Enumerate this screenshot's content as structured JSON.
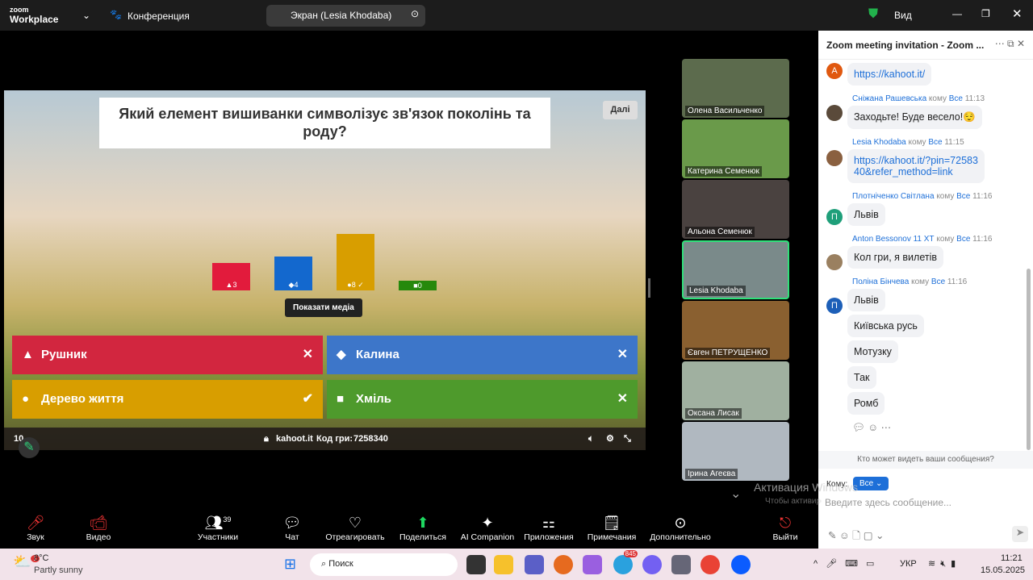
{
  "topbar": {
    "logo_top": "zoom",
    "logo_bottom": "Workplace",
    "meeting": "Конференция",
    "screen_label": "Экран (Lesia Khodaba)",
    "view": "Вид"
  },
  "kahoot": {
    "question": "Який елемент вишиванки символізує зв'язок поколінь та роду?",
    "next": "Далі",
    "bars": [
      "3",
      "4",
      "8",
      "0"
    ],
    "show_media": "Показати медіа",
    "answers": [
      "Рушник",
      "Калина",
      "Дерево життя",
      "Хміль"
    ],
    "counter": "10",
    "site": "kahoot.it",
    "code_label": "Код гри:",
    "code": "7258340"
  },
  "gallery": [
    "Олена Васильченко",
    "Катерина Семенюк",
    "Альона Семенюк",
    "Lesia Khodaba",
    "Євген ПЕТРУЩЕНКО",
    "Оксана Лисак",
    "Ірина Агеєва"
  ],
  "chat": {
    "title": "Zoom meeting invitation - Zoom ...",
    "to_word": "кому",
    "to_all": "Все",
    "messages": [
      {
        "sender": "",
        "time": "",
        "avatar": "A",
        "text": "https://kahoot.it/",
        "link": true
      },
      {
        "sender": "Сніжана Рашевська",
        "time": "11:13",
        "text": "Заходьте! Буде весело!😌"
      },
      {
        "sender": "Lesia Khodaba",
        "time": "11:15",
        "text": "https://kahoot.it/?pin=7258340&refer_method=link",
        "link": true
      },
      {
        "sender": "Плотніченко Світлана",
        "time": "11:16",
        "avatar": "П",
        "text": "Львів"
      },
      {
        "sender": "Anton Bessonov 11 ХТ",
        "time": "11:16",
        "text": "Кол гри, я вилетів"
      },
      {
        "sender": "Поліна Бінчева",
        "time": "11:16",
        "avatar": "П",
        "text": "Львів"
      }
    ],
    "extra": [
      "Київська русь",
      "Мотузку",
      "Так",
      "Ромб"
    ],
    "who_sees": "Кто может видеть ваши сообщения?",
    "to_label": "Кому:",
    "to_value": "Все",
    "placeholder": "Введите здесь сообщение...",
    "watermark": "Активация Windows",
    "watermark2": "Чтобы активировать Windows, перейдите в раздел \"Параметры\"."
  },
  "toolbar": {
    "audio": "Звук",
    "video": "Видео",
    "participants": "Участники",
    "participants_count": "39",
    "chat": "Чат",
    "react": "Отреагировать",
    "share": "Поделиться",
    "ai": "AI Companion",
    "apps": "Приложения",
    "notes": "Примечания",
    "more": "Дополнительно",
    "leave": "Выйти"
  },
  "taskbar": {
    "temp": "8°C",
    "weather": "Partly sunny",
    "search": "Поиск",
    "lang": "УКР",
    "time": "11:21",
    "date": "15.05.2025",
    "telegram_badge": "845",
    "weather_badge": "1"
  }
}
